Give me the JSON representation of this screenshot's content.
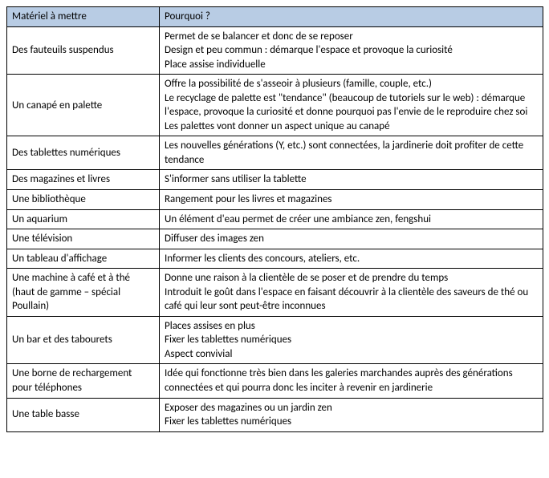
{
  "header": {
    "col1": "Matériel à mettre",
    "col2": "Pourquoi ?"
  },
  "rows": [
    {
      "material": "Des fauteuils suspendus",
      "reasons": [
        "Permet de se balancer et donc de se reposer",
        "Design et peu commun : démarque l'espace et provoque la curiosité",
        "Place assise individuelle"
      ]
    },
    {
      "material": "Un canapé en palette",
      "reasons": [
        "Offre la possibilité de s'asseoir à plusieurs (famille, couple, etc.)",
        "Le recyclage de palette est \"tendance\" (beaucoup de tutoriels sur le web) : démarque l'espace, provoque la curiosité et donne pourquoi pas l'envie de le reproduire chez soi",
        "Les palettes vont donner un aspect unique au canapé"
      ]
    },
    {
      "material": "Des tablettes numériques",
      "reasons": [
        "Les nouvelles générations (Y, etc.) sont connectées, la jardinerie doit profiter de cette tendance"
      ]
    },
    {
      "material": "Des magazines et livres",
      "reasons": [
        "S'informer sans utiliser la tablette"
      ]
    },
    {
      "material": "Une bibliothèque",
      "reasons": [
        "Rangement pour les livres et magazines"
      ]
    },
    {
      "material": "Un aquarium",
      "reasons": [
        "Un élément d'eau permet de créer une ambiance zen, fengshui"
      ]
    },
    {
      "material": "Une télévision",
      "reasons": [
        "Diffuser des images zen"
      ]
    },
    {
      "material": "Un tableau d'affichage",
      "reasons": [
        "Informer les clients des concours, ateliers, etc."
      ]
    },
    {
      "material": "Une machine à café et à thé (haut de gamme – spécial Poullain)",
      "reasons": [
        "Donne une raison à la clientèle de se poser et de prendre du temps",
        "Introduit le goût dans l'espace en faisant découvrir à la clientèle des saveurs de thé ou café qui leur sont peut-être inconnues"
      ]
    },
    {
      "material": "Un bar et des tabourets",
      "reasons": [
        "Places assises en plus",
        "Fixer les tablettes numériques",
        "Aspect convivial"
      ]
    },
    {
      "material": "Une borne de rechargement pour téléphones",
      "reasons": [
        "Idée qui fonctionne très bien dans les galeries marchandes auprès des générations connectées et qui pourra donc les inciter à revenir en jardinerie"
      ]
    },
    {
      "material": "Une table basse",
      "reasons": [
        "Exposer des magazines ou un jardin zen",
        "Fixer les tablettes numériques"
      ]
    }
  ]
}
